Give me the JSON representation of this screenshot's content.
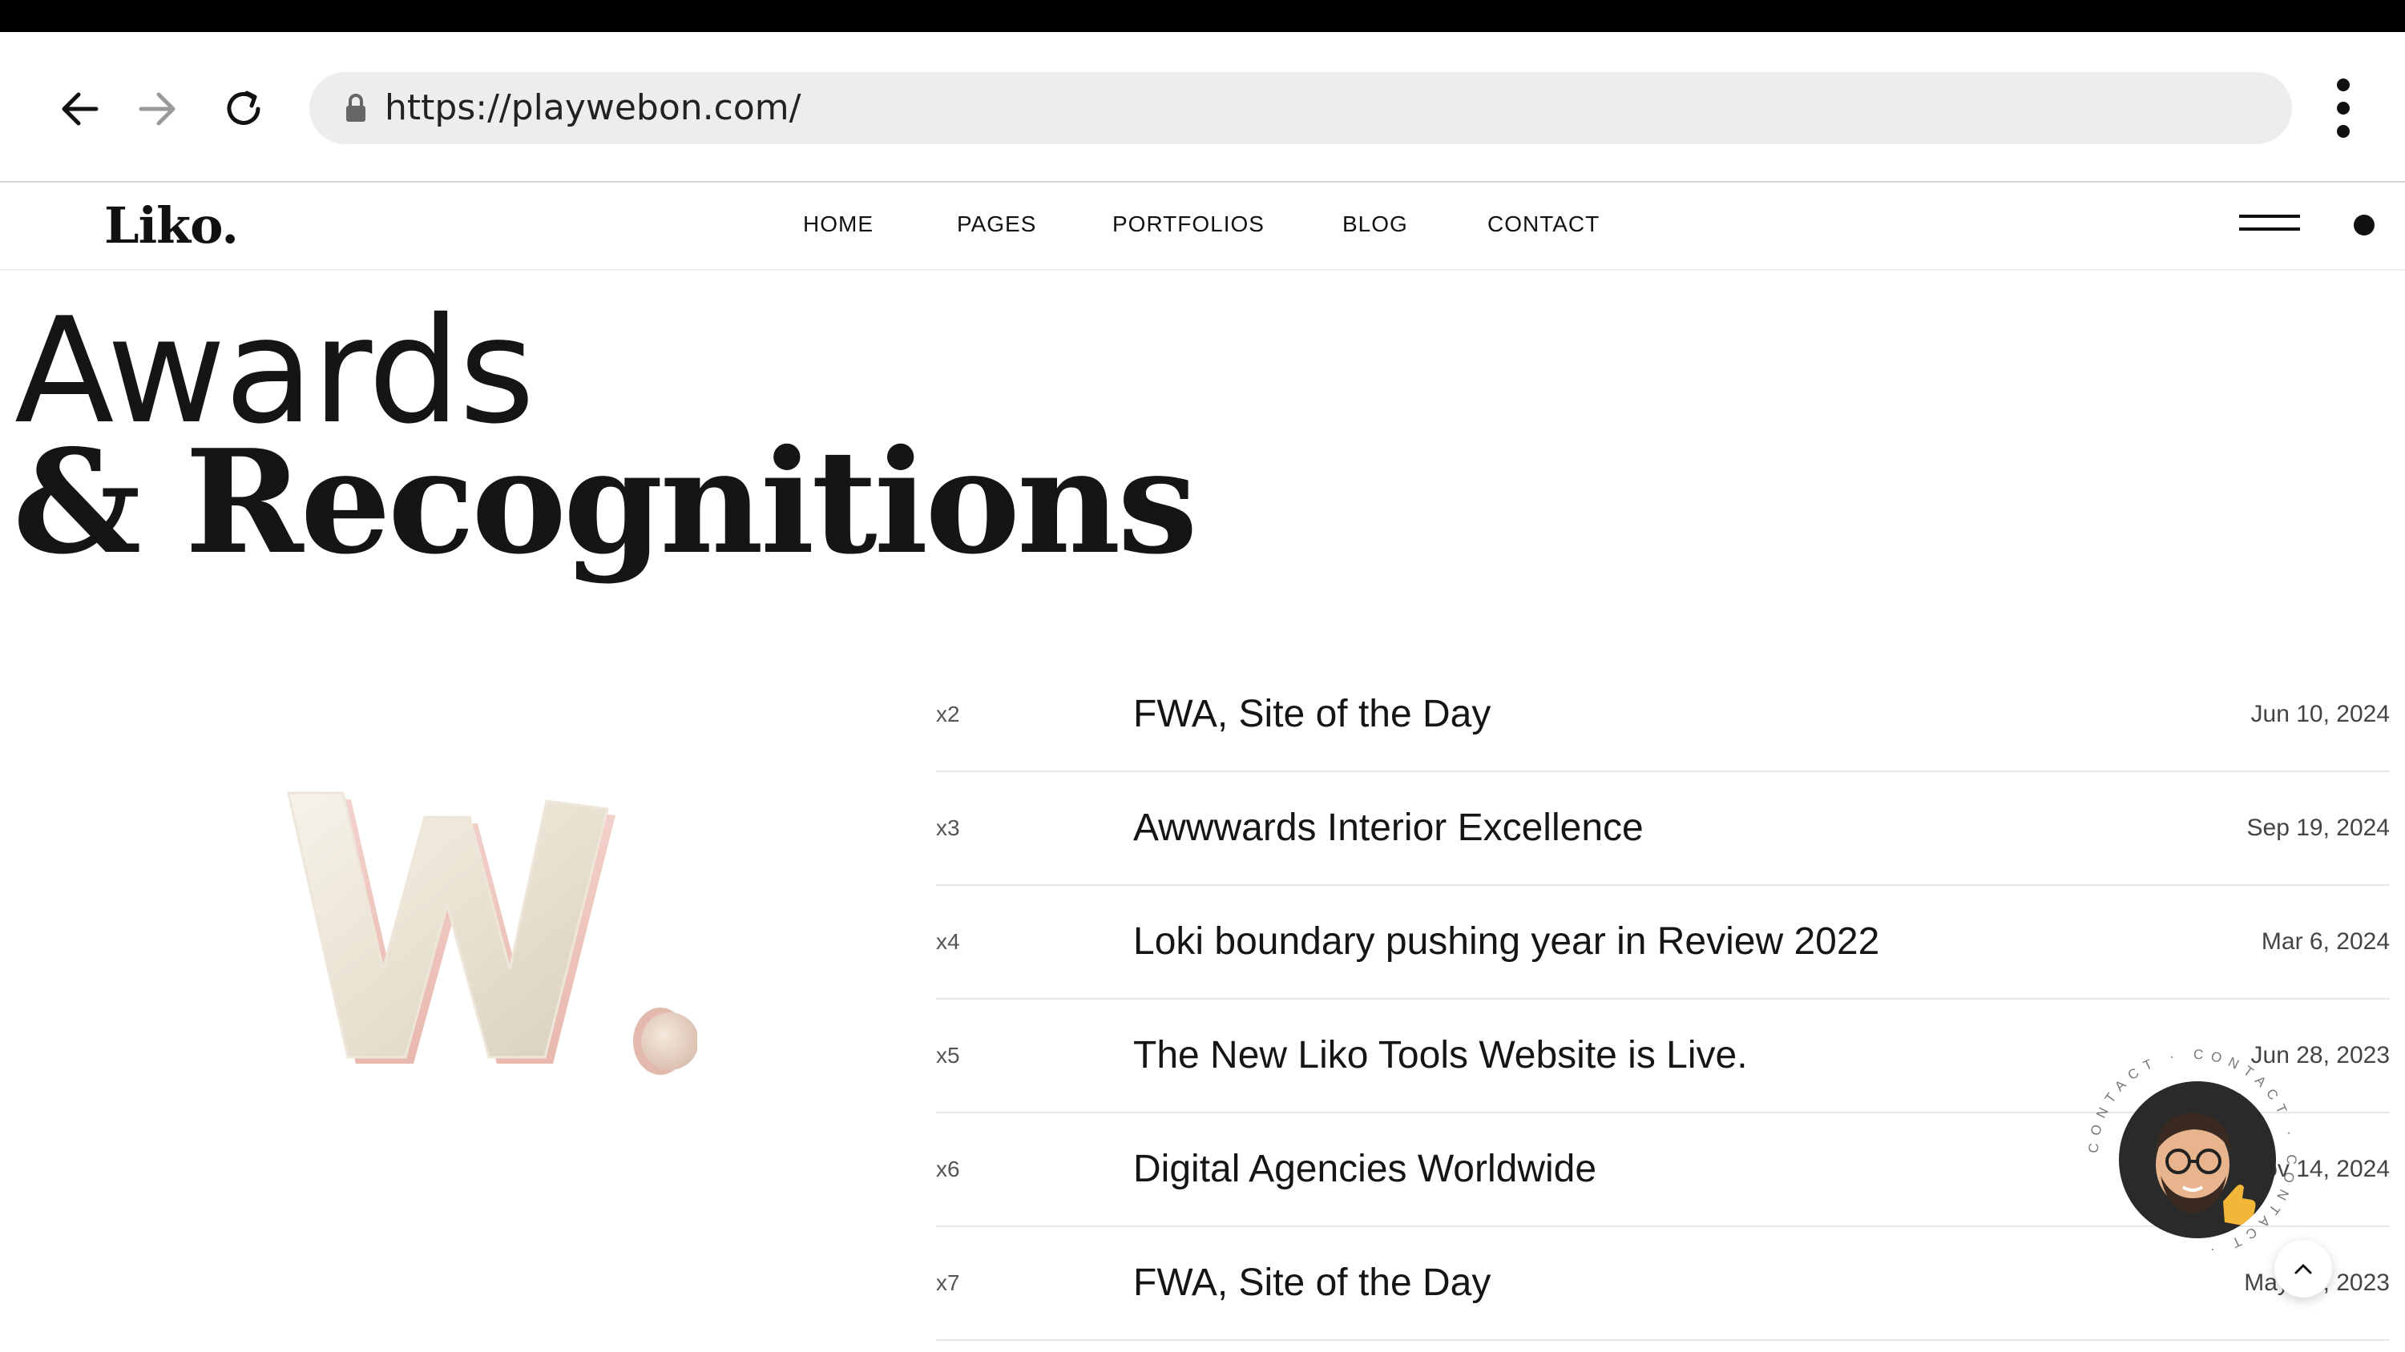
{
  "browser": {
    "url": "https://playwebon.com/",
    "back_icon": "arrow-left-icon",
    "forward_icon": "arrow-right-icon",
    "reload_icon": "reload-icon",
    "lock_icon": "lock-icon",
    "menu_icon": "kebab-menu-icon"
  },
  "site": {
    "logo": "Liko.",
    "nav": [
      "HOME",
      "PAGES",
      "PORTFOLIOS",
      "BLOG",
      "CONTACT"
    ]
  },
  "hero": {
    "title_line1": "Awards",
    "title_line2": "& Recognitions"
  },
  "awards": [
    {
      "count": "x2",
      "title": "FWA, Site of the Day",
      "date": "Jun 10, 2024"
    },
    {
      "count": "x3",
      "title": "Awwwards Interior Excellence",
      "date": "Sep 19, 2024"
    },
    {
      "count": "x4",
      "title": "Loki boundary pushing year in Review 2022",
      "date": "Mar 6, 2024"
    },
    {
      "count": "x5",
      "title": "The New Liko Tools Website is Live.",
      "date": "Jun 28, 2023"
    },
    {
      "count": "x6",
      "title": "Digital Agencies Worldwide",
      "date": "ov 14, 2024"
    },
    {
      "count": "x7",
      "title": "FWA, Site of the Day",
      "date": "May 31, 2023"
    }
  ],
  "contact_widget": {
    "ring_text": "CONTACT · CONTACT · CONTACT ·"
  },
  "colors": {
    "text": "#151515",
    "divider": "#e6e6e6",
    "url_bar": "#ededed"
  }
}
